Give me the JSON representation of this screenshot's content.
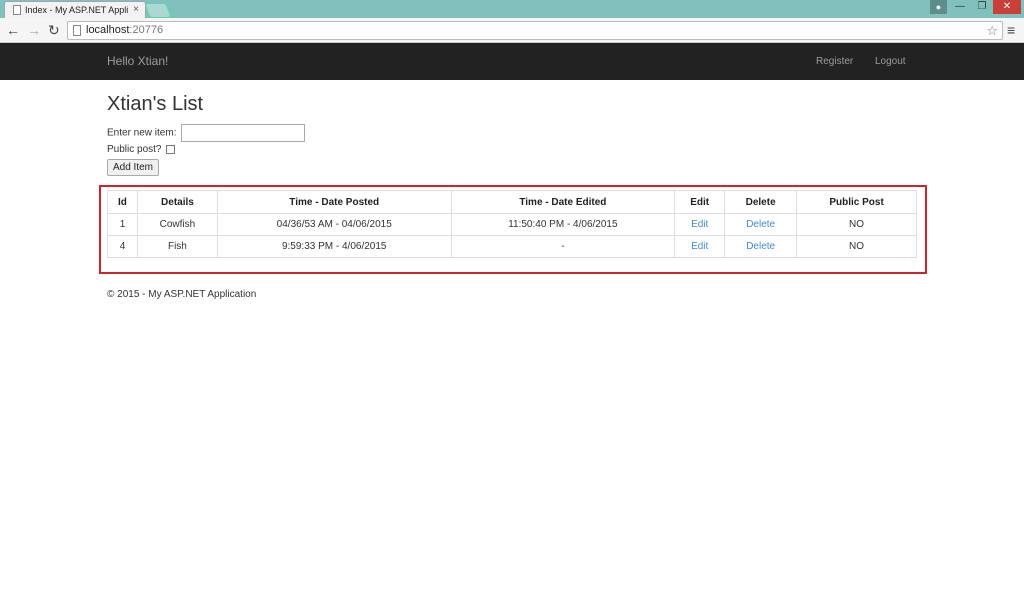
{
  "browser": {
    "tab_title": "Index - My ASP.NET Appli",
    "tab_close": "×",
    "user_icon": "user-icon",
    "url_host": "localhost",
    "url_port": ":20776"
  },
  "navbar": {
    "brand": "Hello Xtian!",
    "register": "Register",
    "logout": "Logout"
  },
  "main": {
    "title": "Xtian's List",
    "new_item_label": "Enter new item:",
    "new_item_value": "",
    "public_label": "Public post?",
    "add_button": "Add Item"
  },
  "table": {
    "headers": [
      "Id",
      "Details",
      "Time - Date Posted",
      "Time - Date Edited",
      "Edit",
      "Delete",
      "Public Post"
    ],
    "rows": [
      {
        "id": "1",
        "details": "Cowfish",
        "posted": "04/36/53 AM - 04/06/2015",
        "edited": "11:50:40 PM - 4/06/2015",
        "edit": "Edit",
        "delete": "Delete",
        "public": "NO"
      },
      {
        "id": "4",
        "details": "Fish",
        "posted": "9:59:33 PM - 4/06/2015",
        "edited": "-",
        "edit": "Edit",
        "delete": "Delete",
        "public": "NO"
      }
    ]
  },
  "footer": {
    "text": "© 2015 - My ASP.NET Application"
  },
  "colors": {
    "navbar_bg": "#222222",
    "link": "#428bca",
    "highlight": "#c7282f",
    "tabstrip": "#7ec1bd"
  }
}
